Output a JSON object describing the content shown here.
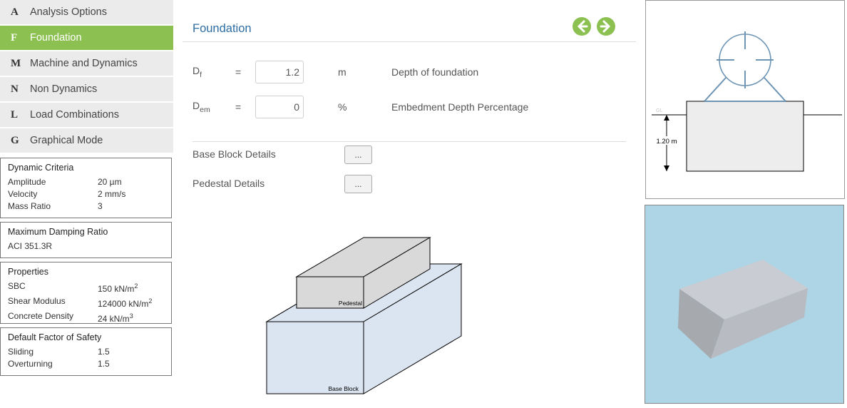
{
  "nav": [
    {
      "letter": "A",
      "label": "Analysis Options"
    },
    {
      "letter": "F",
      "label": "Foundation"
    },
    {
      "letter": "M",
      "label": "Machine and Dynamics"
    },
    {
      "letter": "N",
      "label": "Non Dynamics"
    },
    {
      "letter": "L",
      "label": "Load Combinations"
    },
    {
      "letter": "G",
      "label": "Graphical Mode"
    }
  ],
  "active_nav": "Foundation",
  "dynamic_criteria": {
    "title": "Dynamic Criteria",
    "rows": [
      {
        "k": "Amplitude",
        "v": "20 µm"
      },
      {
        "k": "Velocity",
        "v": "2 mm/s"
      },
      {
        "k": "Mass Ratio",
        "v": "3"
      }
    ]
  },
  "damping": {
    "title": "Maximum Damping Ratio",
    "value": "ACI 351.3R"
  },
  "properties": {
    "title": "Properties",
    "sbc": {
      "k": "SBC",
      "v": "150 kN/m",
      "sup": "2"
    },
    "shear": {
      "k": "Shear Modulus",
      "v": "124000 kN/m",
      "sup": "2"
    },
    "density": {
      "k": "Concrete Density",
      "v": "24 kN/m",
      "sup": "3"
    }
  },
  "safety": {
    "title": "Default Factor of Safety",
    "rows": [
      {
        "k": "Sliding",
        "v": "1.5"
      },
      {
        "k": "Overturning",
        "v": "1.5"
      }
    ]
  },
  "main": {
    "title": "Foundation",
    "params": [
      {
        "sym": "D",
        "sub": "f",
        "eq": "=",
        "value": "1.2",
        "unit": "m",
        "desc": "Depth of foundation"
      },
      {
        "sym": "D",
        "sub": "em",
        "eq": "=",
        "value": "0",
        "unit": "%",
        "desc": "Embedment Depth Percentage"
      }
    ],
    "base_block_label": "Base Block Details",
    "pedestal_label": "Pedestal Details",
    "dots_label": "...",
    "iso_labels": {
      "pedestal": "Pedestal",
      "base": "Base Block"
    }
  },
  "sketch": {
    "depth_label": "1.20 m",
    "ground_label": "GL"
  },
  "colors": {
    "accent": "#8cc152",
    "title_blue": "#2e6ea3",
    "view_bg": "#add5e6",
    "machine_stroke": "#6f95b5"
  },
  "icons": {
    "back": "arrow-left-circle-icon",
    "forward": "arrow-right-circle-icon"
  }
}
